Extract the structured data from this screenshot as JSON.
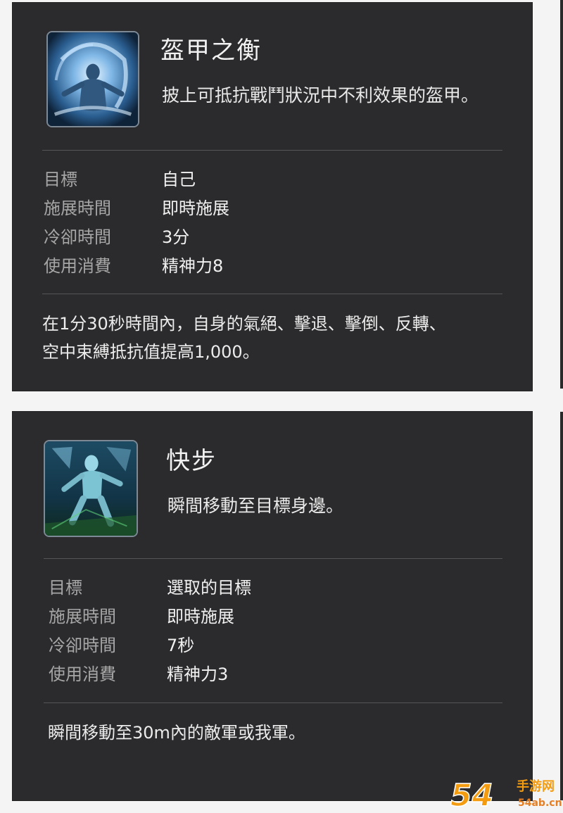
{
  "skills": [
    {
      "name": "盔甲之衡",
      "description": "披上可抵抗戰鬥狀況中不利效果的盔甲。",
      "icon": "armor-aura-icon",
      "stats": [
        {
          "label": "目標",
          "value": "自己"
        },
        {
          "label": "施展時間",
          "value": "即時施展"
        },
        {
          "label": "冷卻時間",
          "value": "3分"
        },
        {
          "label": "使用消費",
          "value": "精神力8"
        }
      ],
      "detail_lines": [
        "在1分30秒時間內，自身的氣絕、擊退、擊倒、反轉、",
        "空中束縛抵抗值提高1,000。"
      ]
    },
    {
      "name": "快步",
      "description": "瞬間移動至目標身邊。",
      "icon": "teleport-step-icon",
      "stats": [
        {
          "label": "目標",
          "value": "選取的目標"
        },
        {
          "label": "施展時間",
          "value": "即時施展"
        },
        {
          "label": "冷卻時間",
          "value": "7秒"
        },
        {
          "label": "使用消費",
          "value": "精神力3"
        }
      ],
      "detail_lines": [
        "瞬間移動至30m內的敵軍或我軍。"
      ]
    }
  ],
  "watermark": {
    "number_text": "54",
    "domain_text": "手游网",
    "url_text": "54ab.cn"
  },
  "colors": {
    "card_bg": "#2b2b2d",
    "label": "#a6a6a6",
    "value": "#f1f1f1",
    "watermark_orange": "#f39c12"
  }
}
